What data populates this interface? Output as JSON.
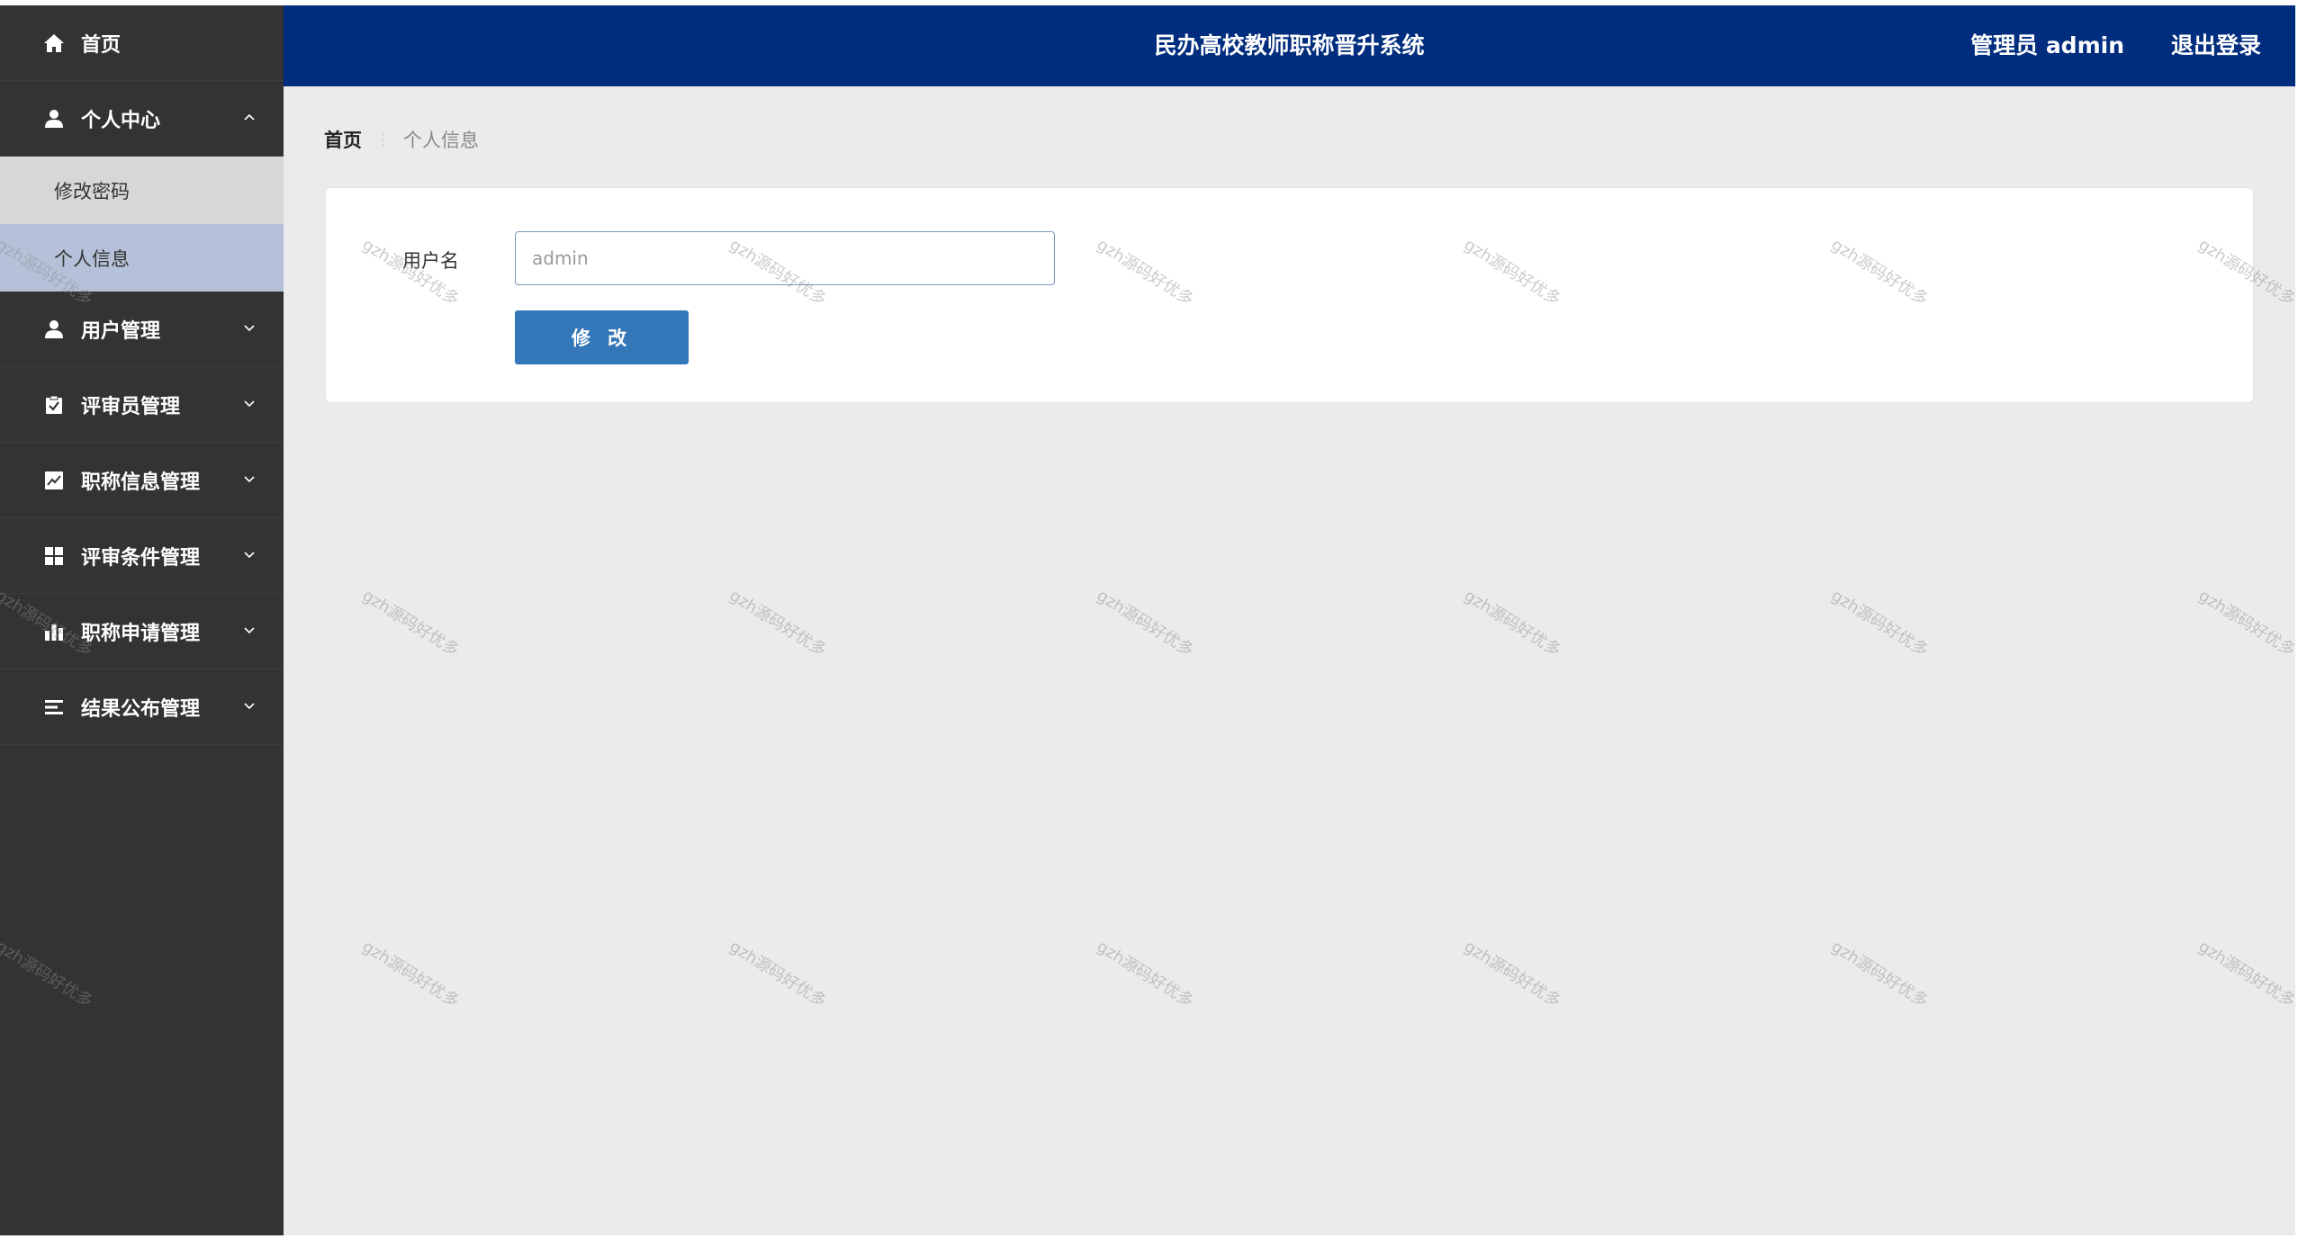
{
  "header": {
    "title": "民办高校教师职称晋升系统",
    "user_label": "管理员 admin",
    "logout_label": "退出登录"
  },
  "sidebar": {
    "items": [
      {
        "label": "首页",
        "icon": "home-icon"
      },
      {
        "label": "个人中心",
        "icon": "user-icon",
        "expanded": true,
        "children": [
          {
            "label": "修改密码"
          },
          {
            "label": "个人信息",
            "active": true
          }
        ]
      },
      {
        "label": "用户管理",
        "icon": "user-icon"
      },
      {
        "label": "评审员管理",
        "icon": "clipboard-check-icon"
      },
      {
        "label": "职称信息管理",
        "icon": "chart-line-icon"
      },
      {
        "label": "评审条件管理",
        "icon": "grid-icon"
      },
      {
        "label": "职称申请管理",
        "icon": "bar-chart-icon"
      },
      {
        "label": "结果公布管理",
        "icon": "list-icon"
      }
    ]
  },
  "breadcrumb": {
    "home": "首页",
    "separator": "⋮",
    "current": "个人信息"
  },
  "form": {
    "username_label": "用户名",
    "username_placeholder": "admin",
    "submit_label": "修 改"
  },
  "watermark": "gzh源码好优多",
  "colors": {
    "sidebar_bg": "#333333",
    "header_bg": "#002d7e",
    "button_bg": "#3377b8",
    "submenu_active_bg": "#b5c1d8",
    "submenu_bg": "#d7d7d7",
    "main_bg": "#ebebeb"
  }
}
